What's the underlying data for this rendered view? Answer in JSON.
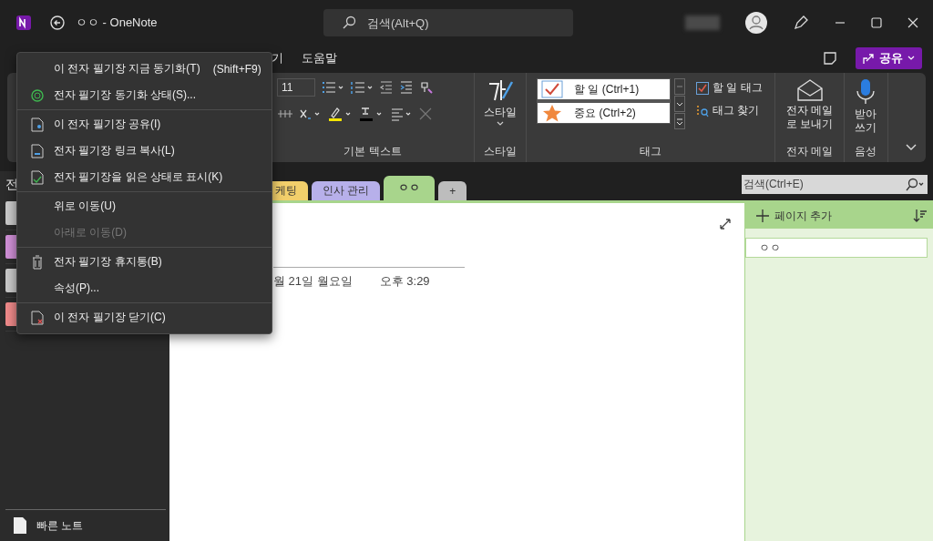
{
  "window": {
    "title": "ㅇㅇ - OneNote",
    "search_placeholder": "검색(Alt+Q)"
  },
  "menu_tabs": [
    {
      "label": "기"
    },
    {
      "label": "도움말"
    }
  ],
  "share_button": {
    "label": "공유"
  },
  "ribbon": {
    "basic_text": {
      "font_size": "11",
      "label": "기본 텍스트"
    },
    "style": {
      "button": "스타일",
      "label": "스타일"
    },
    "tags": {
      "label": "태그",
      "items": [
        {
          "label": "할 일 (Ctrl+1)",
          "kind": "todo"
        },
        {
          "label": "중요 (Ctrl+2)",
          "kind": "star"
        }
      ],
      "actions": [
        {
          "label": "할 일 태그",
          "kind": "todo"
        },
        {
          "label": "태그 찾기",
          "kind": "find"
        }
      ]
    },
    "email": {
      "button": "전자 메일로 보내기",
      "label": "전자 메일"
    },
    "voice": {
      "button": "받아쓰기",
      "label": "음성"
    }
  },
  "sidebar": {
    "header": "전",
    "notebooks": [
      {
        "color": "#c9c9c9"
      },
      {
        "color": "#cf8fd6"
      },
      {
        "color": "#c9c9c9"
      },
      {
        "color": "#ef8a8a"
      }
    ],
    "quick_notes": "빠른 노트"
  },
  "section_tabs": [
    {
      "label": "케팅",
      "color": "#f2cf6b",
      "selected": false
    },
    {
      "label": "인사 관리",
      "color": "#b7b0ea",
      "selected": false
    },
    {
      "label": "ㅇㅇ",
      "color": "#a8d58c",
      "selected": true
    },
    {
      "label": "+",
      "color": "#bdbdbd",
      "selected": false
    }
  ],
  "section_search": {
    "placeholder": "검색(Ctrl+E)"
  },
  "page": {
    "date": "월 21일 월요일",
    "time": "오후 3:29"
  },
  "pages_pane": {
    "add_page": "페이지 추가",
    "pages": [
      {
        "title": "ㅇㅇ",
        "selected": true
      }
    ]
  },
  "context_menu": {
    "sections": [
      {
        "items": [
          {
            "label": "이 전자 필기장 지금 동기화(T)",
            "shortcut": "(Shift+F9)",
            "kind": "plain",
            "disabled": false
          },
          {
            "label": "전자 필기장 동기화 상태(S)...",
            "kind": "sync",
            "disabled": false
          }
        ]
      },
      {
        "items": [
          {
            "label": "이 전자 필기장 공유(I)",
            "kind": "share",
            "disabled": false
          },
          {
            "label": "전자 필기장 링크 복사(L)",
            "kind": "link",
            "disabled": false
          },
          {
            "label": "전자 필기장을 읽은 상태로 표시(K)",
            "kind": "read",
            "disabled": false
          }
        ]
      },
      {
        "items": [
          {
            "label": "위로 이동(U)",
            "kind": "plain",
            "disabled": false
          },
          {
            "label": "아래로 이동(D)",
            "kind": "plain",
            "disabled": true
          }
        ]
      },
      {
        "items": [
          {
            "label": "전자 필기장 휴지통(B)",
            "kind": "trash",
            "disabled": false
          },
          {
            "label": "속성(P)...",
            "kind": "plain",
            "disabled": false
          }
        ]
      },
      {
        "items": [
          {
            "label": "이 전자 필기장 닫기(C)",
            "kind": "close",
            "disabled": false
          }
        ]
      }
    ]
  }
}
